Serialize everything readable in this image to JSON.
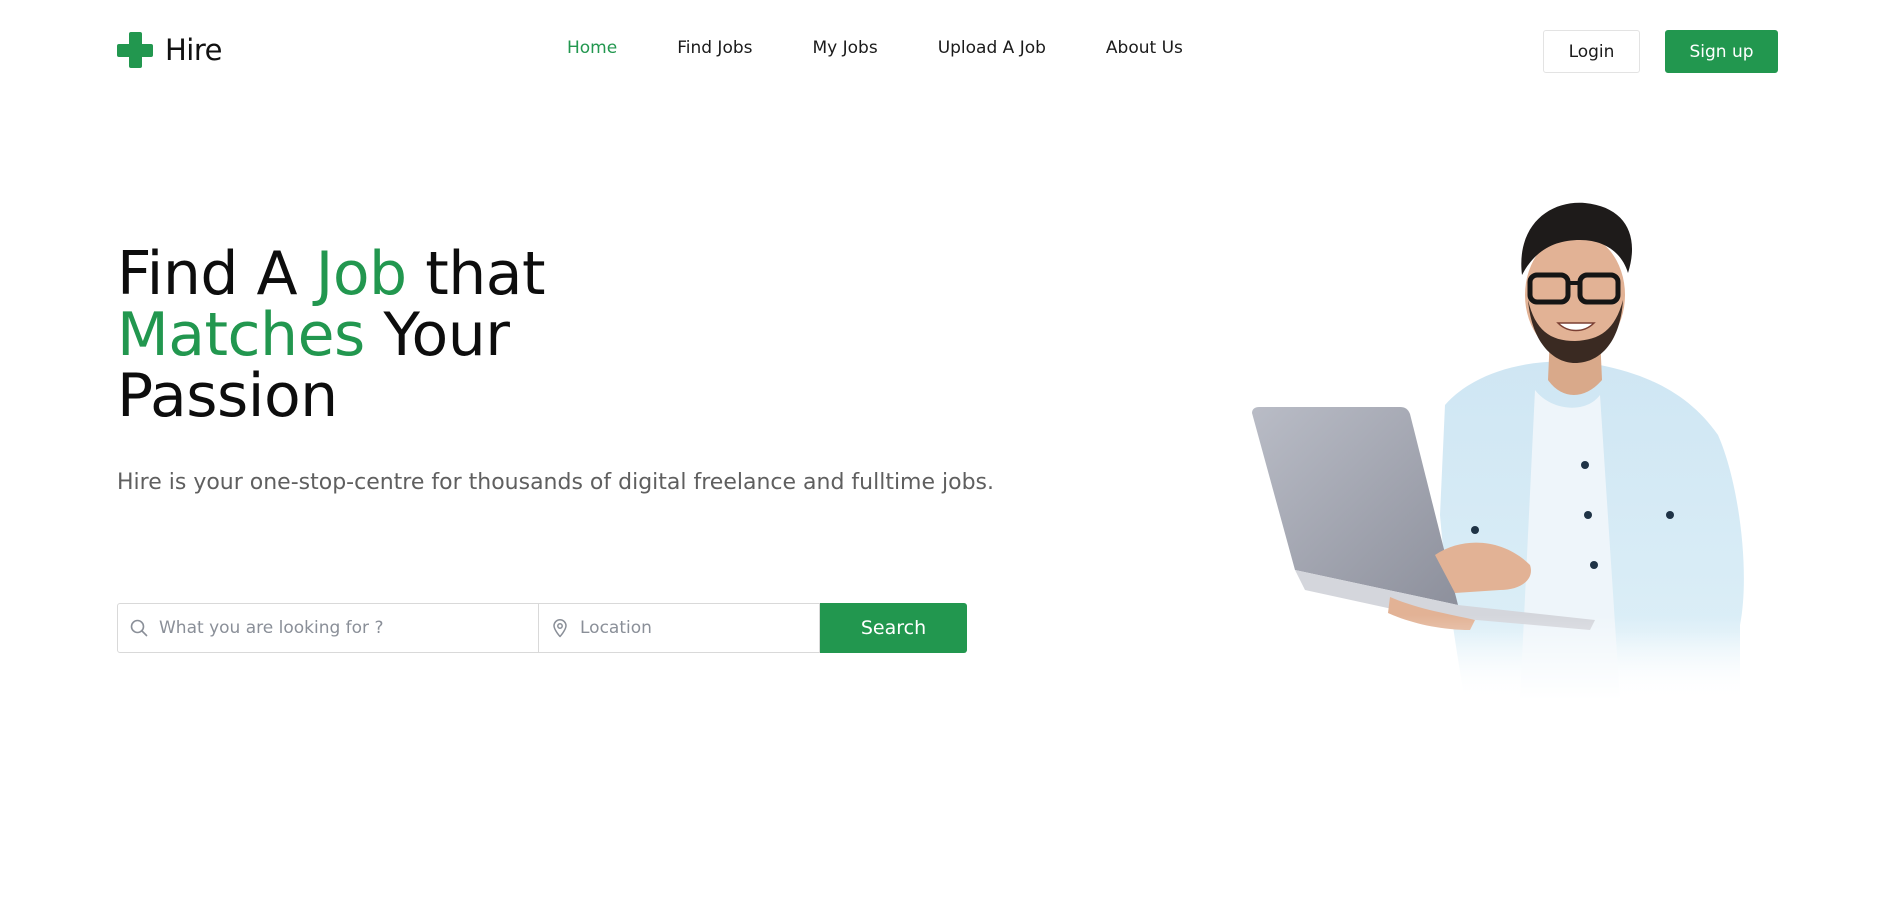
{
  "brand": {
    "name": "Hire",
    "accent_color": "#22974f",
    "logo_icon": "plus-cross-icon"
  },
  "nav": {
    "items": [
      {
        "label": "Home",
        "active": true
      },
      {
        "label": "Find Jobs",
        "active": false
      },
      {
        "label": "My Jobs",
        "active": false
      },
      {
        "label": "Upload A Job",
        "active": false
      },
      {
        "label": "About Us",
        "active": false
      }
    ]
  },
  "auth": {
    "login_label": "Login",
    "signup_label": "Sign up"
  },
  "hero": {
    "title_part1": "Find A ",
    "title_highlight1": "Job",
    "title_part2": " that",
    "title_highlight2": "Matches",
    "title_part3": " Your",
    "title_part4": "Passion",
    "subtitle": "Hire is your one-stop-centre for thousands of digital freelance and fulltime jobs."
  },
  "search": {
    "query_placeholder": "What you are looking for ?",
    "location_placeholder": "Location",
    "button_label": "Search",
    "query_icon": "search-icon",
    "location_icon": "map-pin-icon"
  },
  "illustration": {
    "subject": "man-with-laptop-image"
  }
}
